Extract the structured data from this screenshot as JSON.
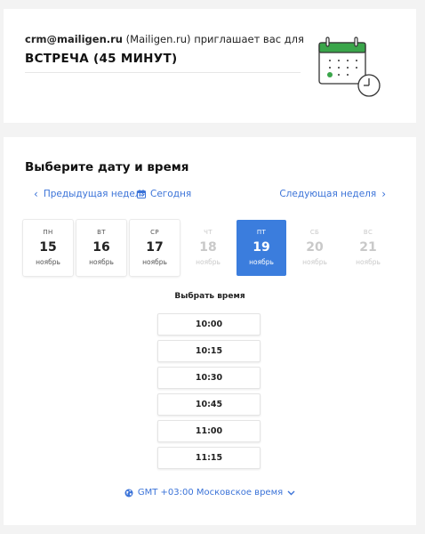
{
  "header": {
    "organizer_email": "crm@mailigen.ru",
    "organizer_name": "(Mailigen.ru)",
    "invite_text": "приглашает вас для",
    "event_title": "ВСТРЕЧА (45 МИНУТ)"
  },
  "picker": {
    "title": "Выберите дату и время",
    "prev_week": "Предыдущая неделя",
    "today": "Сегодня",
    "next_week": "Следующая неделя",
    "days": [
      {
        "name": "пн",
        "date": "15",
        "month": "ноябрь",
        "state": "available"
      },
      {
        "name": "вт",
        "date": "16",
        "month": "ноябрь",
        "state": "available"
      },
      {
        "name": "ср",
        "date": "17",
        "month": "ноябрь",
        "state": "available"
      },
      {
        "name": "чт",
        "date": "18",
        "month": "ноябрь",
        "state": "disabled"
      },
      {
        "name": "пт",
        "date": "19",
        "month": "ноябрь",
        "state": "selected"
      },
      {
        "name": "сб",
        "date": "20",
        "month": "ноябрь",
        "state": "disabled"
      },
      {
        "name": "вс",
        "date": "21",
        "month": "ноябрь",
        "state": "disabled"
      }
    ],
    "time_title": "Выбрать время",
    "slots": [
      "10:00",
      "10:15",
      "10:30",
      "10:45",
      "11:00",
      "11:15"
    ],
    "timezone": "GMT +03:00 Московское время"
  },
  "colors": {
    "accent": "#3b7ddd",
    "link": "#3b73d8",
    "calendar_green": "#3aa54a"
  }
}
